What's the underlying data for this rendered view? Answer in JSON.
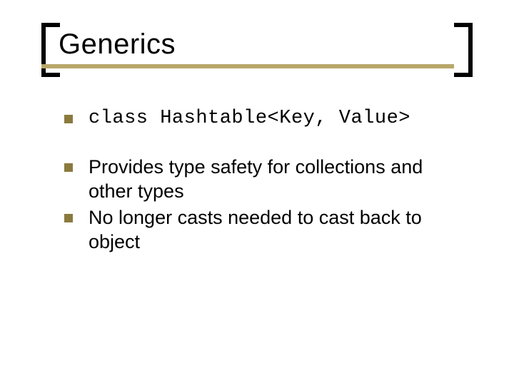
{
  "title": "Generics",
  "bullets": {
    "b1": "class Hashtable<Key, Value>",
    "b2": "Provides type safety for collections and other types",
    "b3": "No longer casts needed to cast back to object"
  }
}
